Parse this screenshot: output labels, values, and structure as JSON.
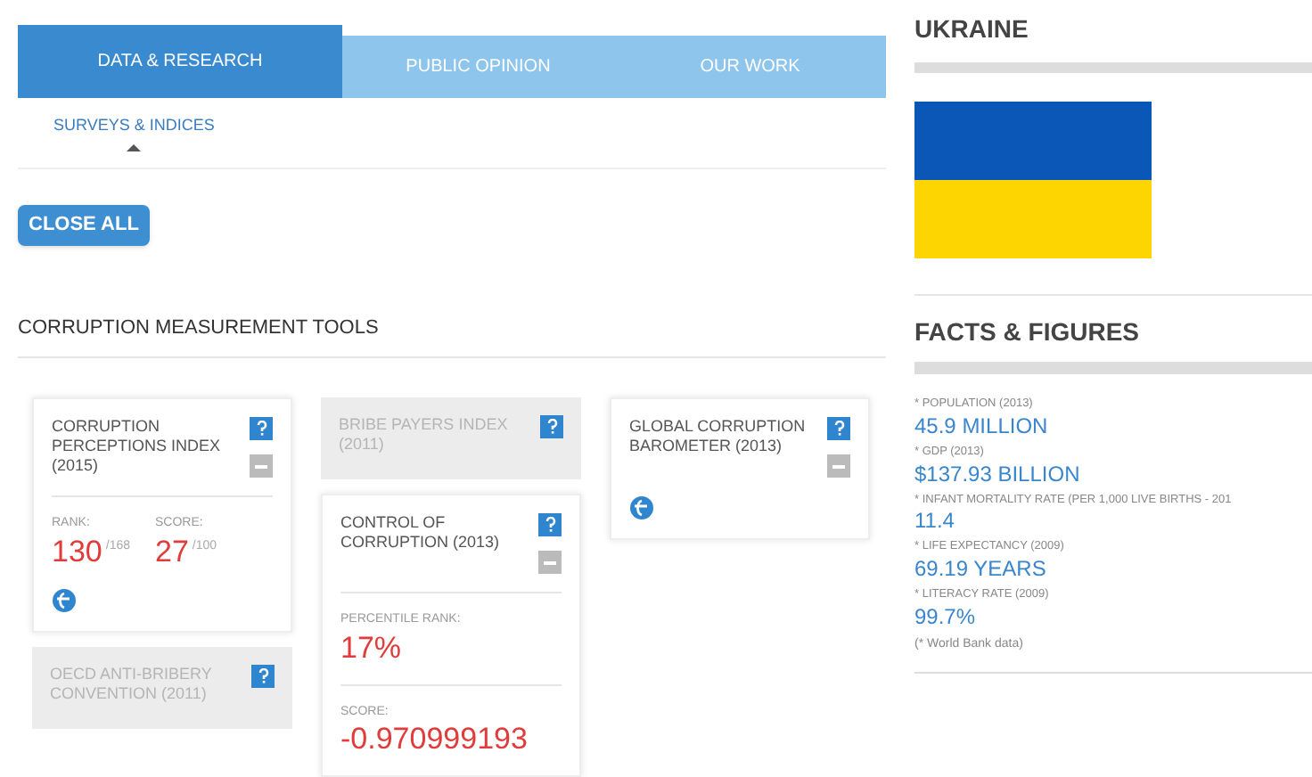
{
  "tabs": [
    {
      "label": "DATA & RESEARCH",
      "selected": true
    },
    {
      "label": "PUBLIC OPINION",
      "selected": false
    },
    {
      "label": "OUR WORK",
      "selected": false
    }
  ],
  "subnav": [
    {
      "label": "SURVEYS & INDICES",
      "selected": true
    }
  ],
  "close_all_button": "CLOSE ALL",
  "section_title": "CORRUPTION MEASUREMENT TOOLS",
  "columns": [
    [
      {
        "title": "CORRUPTION PERCEPTIONS INDEX (2015)",
        "disabled": false,
        "collapsible": true,
        "link": true,
        "stats": [
          [
            {
              "label": "RANK:",
              "value": "130",
              "suffix": "/168"
            },
            {
              "label": "SCORE:",
              "value": "27",
              "suffix": "/100"
            }
          ]
        ]
      },
      {
        "title": "OECD ANTI-BRIBERY CONVENTION (2011)",
        "disabled": true,
        "collapsible": false,
        "link": false
      }
    ],
    [
      {
        "title": "BRIBE PAYERS INDEX (2011)",
        "disabled": true,
        "collapsible": false,
        "link": false
      },
      {
        "title": "CONTROL OF CORRUPTION (2013)",
        "disabled": false,
        "collapsible": true,
        "link": false,
        "stats": [
          [
            {
              "label": "PERCENTILE RANK:",
              "value": "17%"
            }
          ],
          [
            {
              "label": "SCORE:",
              "value": "-0.970999193"
            }
          ]
        ]
      }
    ],
    [
      {
        "title": "GLOBAL CORRUPTION BAROMETER (2013)",
        "disabled": false,
        "collapsible": true,
        "link": true
      }
    ]
  ],
  "country": {
    "name": "UKRAINE",
    "facts_title": "FACTS & FIGURES",
    "facts": [
      {
        "label": "* POPULATION (2013)",
        "value": "45.9 MILLION"
      },
      {
        "label": "* GDP (2013)",
        "value": "$137.93 BILLION"
      },
      {
        "label": "* INFANT MORTALITY RATE (PER 1,000 LIVE BIRTHS - 201",
        "value": "11.4"
      },
      {
        "label": "* LIFE EXPECTANCY (2009)",
        "value": "69.19 YEARS"
      },
      {
        "label": "* LITERACY RATE (2009)",
        "value": "99.7%"
      }
    ],
    "note": "(* World Bank data)"
  }
}
